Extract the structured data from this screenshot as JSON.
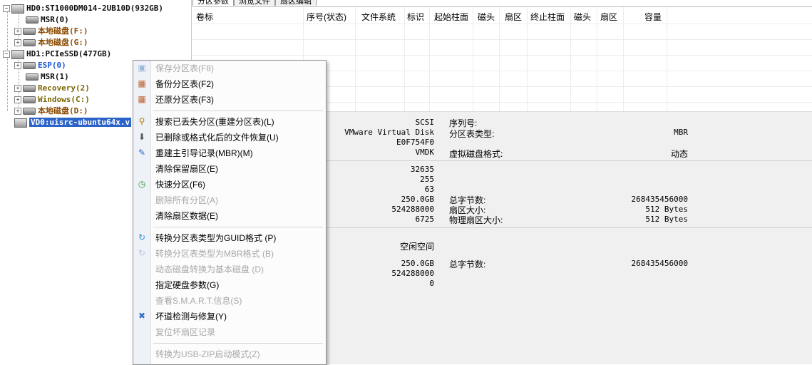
{
  "tree": {
    "items": [
      {
        "label": "HD0:ST1000DM014-2UB10D(932GB)",
        "color": "#111111"
      },
      {
        "label": "MSR(0)",
        "color": "#111111"
      },
      {
        "label": "本地磁盘(F:)",
        "color": "#8a4a00"
      },
      {
        "label": "本地磁盘(G:)",
        "color": "#8a4a00"
      },
      {
        "label": "HD1:PCIeSSD(477GB)",
        "color": "#111111"
      },
      {
        "label": "ESP(0)",
        "color": "#1a56d6"
      },
      {
        "label": "MSR(1)",
        "color": "#111111"
      },
      {
        "label": "Recovery(2)",
        "color": "#7a6500"
      },
      {
        "label": "Windows(C:)",
        "color": "#7a6500"
      },
      {
        "label": "本地磁盘(D:)",
        "color": "#8a4a00"
      },
      {
        "label": "VD0:uisrc-ubuntu64x.v",
        "color": "#ffffff"
      }
    ]
  },
  "tabs": [
    "分区参数",
    "浏览文件",
    "扇区编辑"
  ],
  "grid": {
    "columns": [
      "卷标",
      "序号(状态)",
      "文件系统",
      "标识",
      "起始柱面",
      "磁头",
      "扇区",
      "终止柱面",
      "磁头",
      "扇区",
      "容量"
    ]
  },
  "info": {
    "values": [
      "SCSI",
      "VMware Virtual Disk",
      "E0F754F0",
      "VMDK",
      "32635",
      "255",
      "63",
      "250.0GB",
      "524288000",
      "6725",
      "250.0GB",
      "524288000",
      "0"
    ],
    "labels": [
      "序列号:",
      "分区表类型:",
      "虚拟磁盘格式:",
      "总字节数:",
      "扇区大小:",
      "物理扇区大小:",
      "空闲空间",
      "总字节数:"
    ],
    "right_values": [
      "MBR",
      "动态",
      "268435456000",
      "512 Bytes",
      "512 Bytes",
      "268435456000"
    ]
  },
  "menu": {
    "items": [
      {
        "label": "保存分区表(F8)",
        "disabled": true,
        "icon": "save-icon"
      },
      {
        "label": "备份分区表(F2)",
        "disabled": false,
        "icon": "backup-icon"
      },
      {
        "label": "还原分区表(F3)",
        "disabled": false,
        "icon": "restore-icon"
      },
      {
        "label": "搜索已丢失分区(重建分区表)(L)",
        "disabled": false,
        "icon": "search-icon"
      },
      {
        "label": "已删除或格式化后的文件恢复(U)",
        "disabled": false,
        "icon": "recover-icon"
      },
      {
        "label": "重建主引导记录(MBR)(M)",
        "disabled": false,
        "icon": "edit-icon"
      },
      {
        "label": "清除保留扇区(E)",
        "disabled": false,
        "icon": ""
      },
      {
        "label": "快速分区(F6)",
        "disabled": false,
        "icon": "clock-icon"
      },
      {
        "label": "删除所有分区(A)",
        "disabled": true,
        "icon": ""
      },
      {
        "label": "清除扇区数据(E)",
        "disabled": false,
        "icon": ""
      },
      {
        "label": "转换分区表类型为GUID格式 (P)",
        "disabled": false,
        "icon": "convert-icon"
      },
      {
        "label": "转换分区表类型为MBR格式 (B)",
        "disabled": true,
        "icon": "convert-icon"
      },
      {
        "label": "动态磁盘转换为基本磁盘 (D)",
        "disabled": true,
        "icon": ""
      },
      {
        "label": "指定硬盘参数(G)",
        "disabled": false,
        "icon": ""
      },
      {
        "label": "查看S.M.A.R.T.信息(S)",
        "disabled": true,
        "icon": ""
      },
      {
        "label": "坏道检测与修复(Y)",
        "disabled": false,
        "icon": "tools-icon"
      },
      {
        "label": "复位坏扇区记录",
        "disabled": true,
        "icon": ""
      },
      {
        "label": "转换为USB-ZIP启动模式(Z)",
        "disabled": true,
        "icon": ""
      }
    ]
  }
}
